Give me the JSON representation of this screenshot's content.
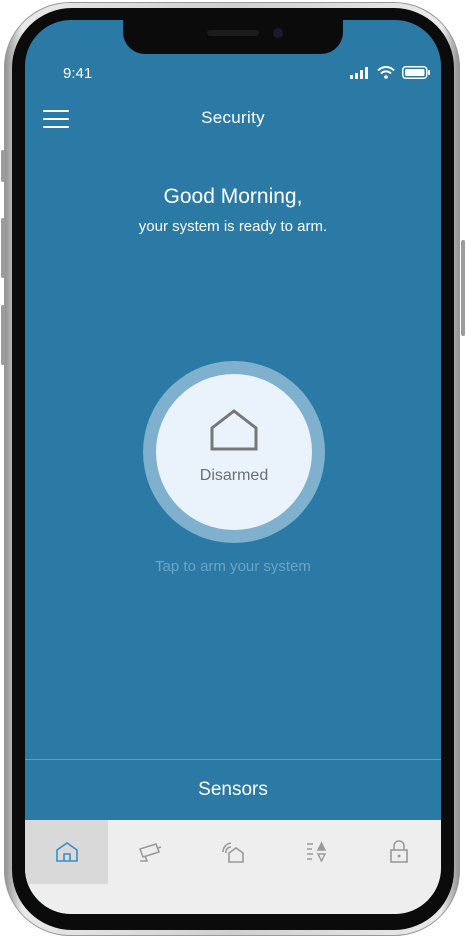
{
  "status_bar": {
    "time": "9:41"
  },
  "header": {
    "title": "Security",
    "menu_icon": "hamburger-menu-icon"
  },
  "greeting": {
    "title": "Good Morning,",
    "subtitle": "your system is ready to arm."
  },
  "arm_control": {
    "status": "Disarmed",
    "icon": "house-icon",
    "hint": "Tap to arm your system"
  },
  "sensors": {
    "label": "Sensors"
  },
  "tabbar": {
    "active_index": 0,
    "tabs": [
      {
        "icon": "home-icon",
        "active": true
      },
      {
        "icon": "camera-icon",
        "active": false
      },
      {
        "icon": "smart-home-icon",
        "active": false
      },
      {
        "icon": "sort-icon",
        "active": false
      },
      {
        "icon": "lock-icon",
        "active": false
      }
    ]
  },
  "colors": {
    "screen_background": "#2b7aa5",
    "arm_button": "#eaf3fb",
    "arm_ring": "#7fb1ce",
    "tabbar": "#eeeeee",
    "active_tab": "#d9d9d9",
    "active_icon": "#3b8cc9",
    "inactive_icon": "#9a9a9a"
  }
}
